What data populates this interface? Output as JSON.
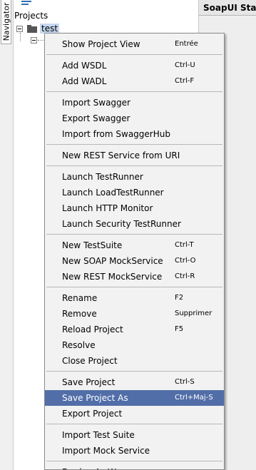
{
  "navigator": {
    "tab_label": "Navigator"
  },
  "tree": {
    "root_label": "Projects",
    "project_label": "test"
  },
  "right_panel": {
    "tab_label": "SoapUI Starter"
  },
  "context_menu": {
    "groups": [
      [
        {
          "label": "Show Project View",
          "shortcut": "Entrée"
        }
      ],
      [
        {
          "label": "Add WSDL",
          "shortcut": "Ctrl-U"
        },
        {
          "label": "Add WADL",
          "shortcut": "Ctrl-F"
        }
      ],
      [
        {
          "label": "Import Swagger",
          "shortcut": ""
        },
        {
          "label": "Export Swagger",
          "shortcut": ""
        },
        {
          "label": "Import from SwaggerHub",
          "shortcut": ""
        }
      ],
      [
        {
          "label": "New REST Service from URI",
          "shortcut": ""
        }
      ],
      [
        {
          "label": "Launch TestRunner",
          "shortcut": ""
        },
        {
          "label": "Launch LoadTestRunner",
          "shortcut": ""
        },
        {
          "label": "Launch HTTP Monitor",
          "shortcut": ""
        },
        {
          "label": "Launch Security TestRunner",
          "shortcut": ""
        }
      ],
      [
        {
          "label": "New TestSuite",
          "shortcut": "Ctrl-T"
        },
        {
          "label": "New SOAP MockService",
          "shortcut": "Ctrl-O"
        },
        {
          "label": "New REST MockService",
          "shortcut": "Ctrl-R"
        }
      ],
      [
        {
          "label": "Rename",
          "shortcut": "F2"
        },
        {
          "label": "Remove",
          "shortcut": "Supprimer"
        },
        {
          "label": "Reload Project",
          "shortcut": "F5"
        },
        {
          "label": "Resolve",
          "shortcut": ""
        },
        {
          "label": "Close Project",
          "shortcut": ""
        }
      ],
      [
        {
          "label": "Save Project",
          "shortcut": "Ctrl-S"
        },
        {
          "label": "Save Project As",
          "shortcut": "Ctrl+Maj-S",
          "selected": true
        },
        {
          "label": "Export Project",
          "shortcut": ""
        }
      ],
      [
        {
          "label": "Import Test Suite",
          "shortcut": ""
        },
        {
          "label": "Import Mock Service",
          "shortcut": ""
        }
      ],
      [
        {
          "label": "Deploy As War",
          "shortcut": ""
        }
      ]
    ]
  },
  "colors": {
    "selection": "#526ea8",
    "tree_selection": "#c5d8f0",
    "menu_background": "#f2f2f2"
  }
}
